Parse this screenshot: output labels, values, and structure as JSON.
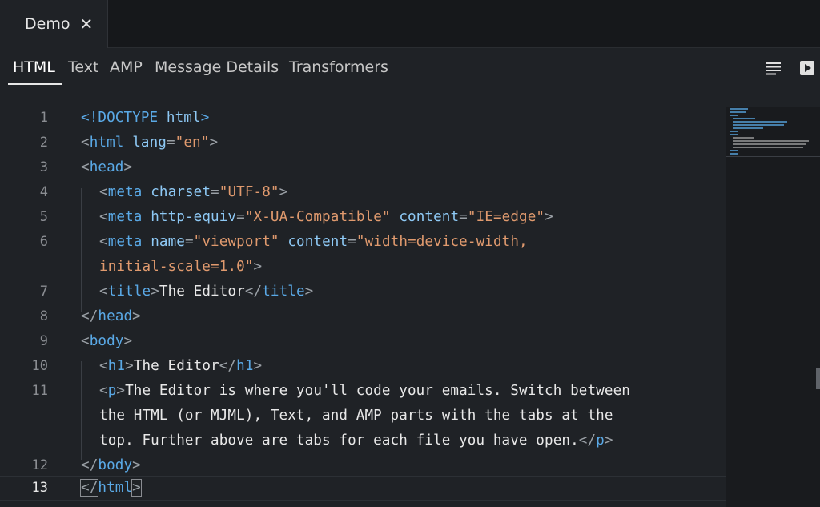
{
  "file_tab": {
    "name": "Demo",
    "close_glyph": "✕"
  },
  "part_tabs": [
    "HTML",
    "Text",
    "AMP",
    "Message Details",
    "Transformers"
  ],
  "active_tab": "HTML",
  "toolbar": {
    "format_icon": "align-lines-icon",
    "preview_icon": "play-icon"
  },
  "line_numbers": [
    "1",
    "2",
    "3",
    "4",
    "5",
    "6",
    "7",
    "8",
    "9",
    "10",
    "11",
    "12",
    "13"
  ],
  "current_line": "13",
  "code": {
    "l1": [
      "<!DOCTYPE",
      " html",
      ">"
    ],
    "l2": [
      "<",
      "html",
      " ",
      "lang",
      "=",
      "\"en\"",
      ">"
    ],
    "l3": [
      "<",
      "head",
      ">"
    ],
    "l4": [
      "<",
      "meta",
      " ",
      "charset",
      "=",
      "\"UTF-8\"",
      ">"
    ],
    "l5": [
      "<",
      "meta",
      " ",
      "http-equiv",
      "=",
      "\"X-UA-Compatible\"",
      " ",
      "content",
      "=",
      "\"IE=edge\"",
      ">"
    ],
    "l6a": [
      "<",
      "meta",
      " ",
      "name",
      "=",
      "\"viewport\"",
      " ",
      "content",
      "=",
      "\"width=device-width,"
    ],
    "l6b": [
      "initial-scale=1.0\"",
      ">"
    ],
    "l7": [
      "<",
      "title",
      ">",
      "The Editor",
      "</",
      "title",
      ">"
    ],
    "l8": [
      "</",
      "head",
      ">"
    ],
    "l9": [
      "<",
      "body",
      ">"
    ],
    "l10": [
      "<",
      "h1",
      ">",
      "The Editor",
      "</",
      "h1",
      ">"
    ],
    "l11a": [
      "<",
      "p",
      ">",
      "The Editor is where you'll code your emails. Switch between"
    ],
    "l11b": "the HTML (or MJML), Text, and AMP parts with the tabs at the",
    "l11c": [
      "top. Further above are tabs for each file you have open.",
      "</",
      "p",
      ">"
    ],
    "l12": [
      "</",
      "body",
      ">"
    ],
    "l13": [
      "</",
      "html",
      ">"
    ]
  },
  "colors": {
    "tag": "#5aa9e6",
    "attr": "#8ec9f5",
    "string": "#e09a6e",
    "text": "#e8e8e8",
    "background": "#1f2226"
  }
}
